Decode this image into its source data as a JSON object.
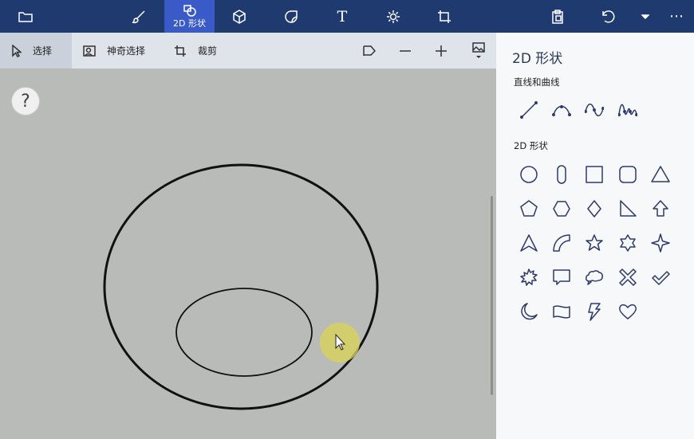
{
  "topbar": {
    "icons": [
      "folder-icon",
      "brush-icon",
      "2d-shapes-icon",
      "3d-shapes-icon",
      "stickers-icon",
      "text-icon",
      "effects-icon",
      "canvas-icon",
      "paste-icon",
      "undo-icon",
      "more-icon",
      "menu-icon"
    ],
    "active_tab_label": "2D 形状",
    "text_tab_glyph": "T",
    "more_glyph": "⋯",
    "active_color": "#3a5bc7",
    "bar_color": "#1e3a6f"
  },
  "toolbar": {
    "select_label": "选择",
    "magic_select_label": "神奇选择",
    "crop_label": "裁剪",
    "icons": [
      "cursor-icon",
      "magic-select-icon",
      "crop-icon",
      "flag-icon",
      "zoom-out-icon",
      "zoom-in-icon",
      "image-icon"
    ]
  },
  "canvas": {
    "help_label": "?",
    "background": "#b8bbb8"
  },
  "panel": {
    "title": "2D 形状",
    "lines_section_label": "直线和曲线",
    "shapes_section_label": "2D 形状",
    "line_tools": [
      "line-icon",
      "curve-icon",
      "s-curve-icon",
      "multi-curve-icon"
    ],
    "shape_tools": [
      "circle-icon",
      "pill-icon",
      "square-icon",
      "rounded-square-icon",
      "triangle-icon",
      "pentagon-icon",
      "hexagon-icon",
      "diamond-icon",
      "right-triangle-icon",
      "arrow-up-icon",
      "arrowhead-icon",
      "quarter-circle-icon",
      "star5-icon",
      "star6-icon",
      "star4-icon",
      "burst-icon",
      "speech-bubble-icon",
      "thought-bubble-icon",
      "x-mark-icon",
      "checkmark-icon",
      "moon-icon",
      "banner-icon",
      "lightning-icon",
      "heart-icon"
    ]
  }
}
